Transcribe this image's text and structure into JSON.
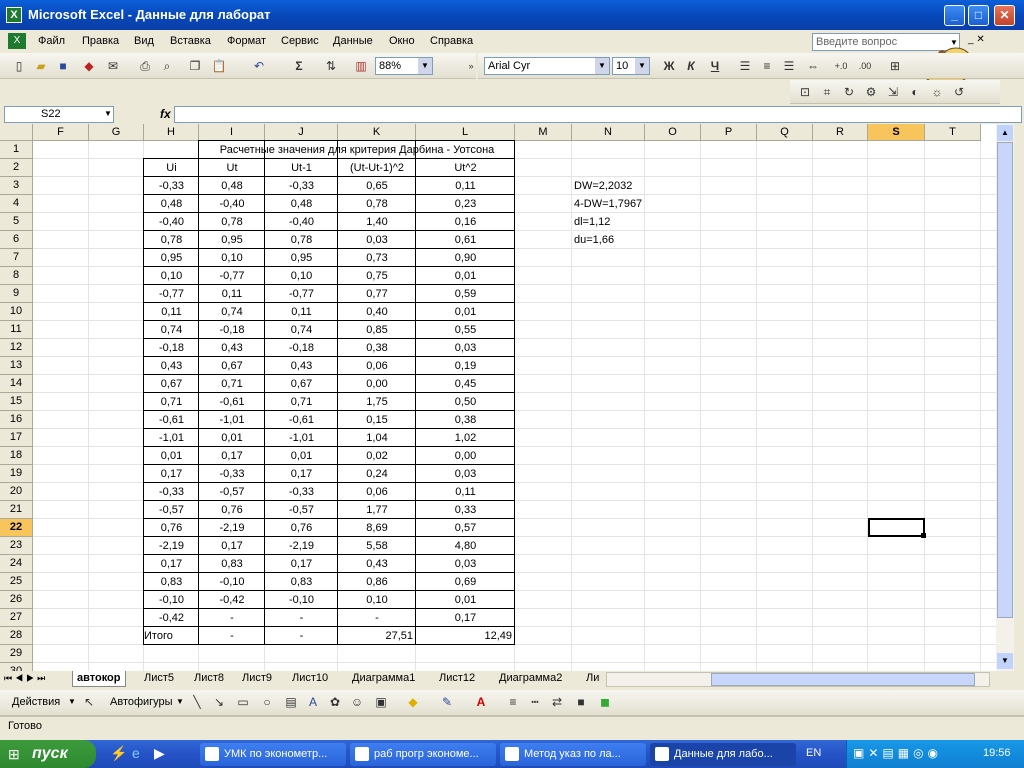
{
  "window": {
    "title": "Microsoft Excel - Данные для лаборат"
  },
  "menu": [
    "Файл",
    "Правка",
    "Вид",
    "Вставка",
    "Формат",
    "Сервис",
    "Данные",
    "Окно",
    "Справка"
  ],
  "help_placeholder": "Введите вопрос",
  "toolbar": {
    "zoom": "88%",
    "font": "Arial Cyr",
    "size": "10",
    "bold": "Ж",
    "italic": "К",
    "underline": "Ч"
  },
  "formula": {
    "namebox": "S22",
    "fx": "fx",
    "value": ""
  },
  "columns": [
    "F",
    "G",
    "H",
    "I",
    "J",
    "K",
    "L",
    "M",
    "N",
    "O",
    "P",
    "Q",
    "R",
    "S",
    "T"
  ],
  "rows": [
    "1",
    "2",
    "3",
    "4",
    "5",
    "6",
    "7",
    "8",
    "9",
    "10",
    "11",
    "12",
    "13",
    "14",
    "15",
    "16",
    "17",
    "18",
    "19",
    "20",
    "21",
    "22",
    "23",
    "24",
    "25",
    "26",
    "27",
    "28",
    "29",
    "30"
  ],
  "table": {
    "title": "Расчетные значения для критерия Дарбина - Уотсона",
    "headers": [
      "Ui",
      "Ut",
      "Ut-1",
      "(Ut-Ut-1)^2",
      "Ut^2"
    ],
    "data": [
      [
        "-0,33",
        "0,48",
        "-0,33",
        "0,65",
        "0,11"
      ],
      [
        "0,48",
        "-0,40",
        "0,48",
        "0,78",
        "0,23"
      ],
      [
        "-0,40",
        "0,78",
        "-0,40",
        "1,40",
        "0,16"
      ],
      [
        "0,78",
        "0,95",
        "0,78",
        "0,03",
        "0,61"
      ],
      [
        "0,95",
        "0,10",
        "0,95",
        "0,73",
        "0,90"
      ],
      [
        "0,10",
        "-0,77",
        "0,10",
        "0,75",
        "0,01"
      ],
      [
        "-0,77",
        "0,11",
        "-0,77",
        "0,77",
        "0,59"
      ],
      [
        "0,11",
        "0,74",
        "0,11",
        "0,40",
        "0,01"
      ],
      [
        "0,74",
        "-0,18",
        "0,74",
        "0,85",
        "0,55"
      ],
      [
        "-0,18",
        "0,43",
        "-0,18",
        "0,38",
        "0,03"
      ],
      [
        "0,43",
        "0,67",
        "0,43",
        "0,06",
        "0,19"
      ],
      [
        "0,67",
        "0,71",
        "0,67",
        "0,00",
        "0,45"
      ],
      [
        "0,71",
        "-0,61",
        "0,71",
        "1,75",
        "0,50"
      ],
      [
        "-0,61",
        "-1,01",
        "-0,61",
        "0,15",
        "0,38"
      ],
      [
        "-1,01",
        "0,01",
        "-1,01",
        "1,04",
        "1,02"
      ],
      [
        "0,01",
        "0,17",
        "0,01",
        "0,02",
        "0,00"
      ],
      [
        "0,17",
        "-0,33",
        "0,17",
        "0,24",
        "0,03"
      ],
      [
        "-0,33",
        "-0,57",
        "-0,33",
        "0,06",
        "0,11"
      ],
      [
        "-0,57",
        "0,76",
        "-0,57",
        "1,77",
        "0,33"
      ],
      [
        "0,76",
        "-2,19",
        "0,76",
        "8,69",
        "0,57"
      ],
      [
        "-2,19",
        "0,17",
        "-2,19",
        "5,58",
        "4,80"
      ],
      [
        "0,17",
        "0,83",
        "0,17",
        "0,43",
        "0,03"
      ],
      [
        "0,83",
        "-0,10",
        "0,83",
        "0,86",
        "0,69"
      ],
      [
        "-0,10",
        "-0,42",
        "-0,10",
        "0,10",
        "0,01"
      ],
      [
        "-0,42",
        "-",
        "-",
        "-",
        "0,17"
      ]
    ],
    "total": [
      "Итого",
      "-",
      "-",
      "27,51",
      "12,49"
    ]
  },
  "stats": [
    "DW=2,2032",
    "4-DW=1,7967",
    "dl=1,12",
    "du=1,66"
  ],
  "sheets": [
    "автокор",
    "Лист5",
    "Лист8",
    "Лист9",
    "Лист10",
    "Диаграмма1",
    "Лист12",
    "Диаграмма2",
    "Ли"
  ],
  "drawbar": {
    "actions": "Действия",
    "autoshapes": "Автофигуры"
  },
  "status": "Готово",
  "taskbar": {
    "start": "пуск",
    "items": [
      "УМК по эконометр...",
      "раб прогр экономе...",
      "Метод указ по ла...",
      "Данные для лабо..."
    ],
    "lang": "EN",
    "clock": "19:56"
  }
}
